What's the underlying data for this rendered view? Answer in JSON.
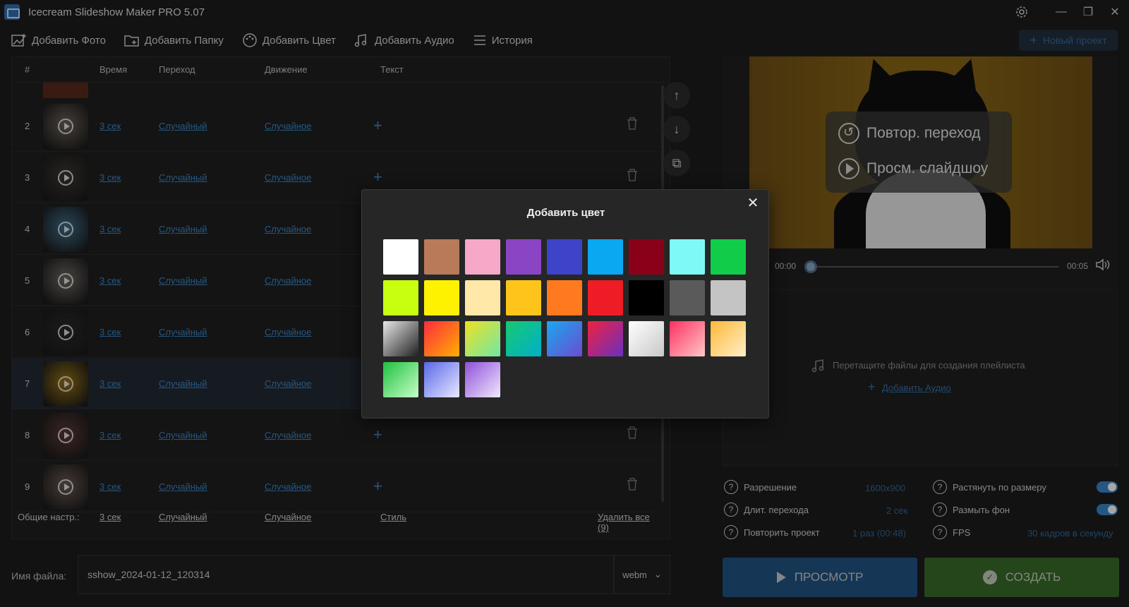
{
  "app": {
    "title": "Icecream Slideshow Maker PRO 5.07"
  },
  "toolbar": {
    "add_photo": "Добавить Фото",
    "add_folder": "Добавить Папку",
    "add_color": "Добавить Цвет",
    "add_audio": "Добавить Аудио",
    "history": "История",
    "new_project": "Новый проект"
  },
  "table": {
    "headers": {
      "num": "#",
      "time": "Время",
      "transition": "Переход",
      "motion": "Движение",
      "text": "Текст"
    },
    "rows": [
      {
        "num": "2",
        "time": "3 сек",
        "transition": "Случайный",
        "motion": "Случайное",
        "thumb_color": "#6b6258"
      },
      {
        "num": "3",
        "time": "3 сек",
        "transition": "Случайный",
        "motion": "Случайное",
        "thumb_color": "#3d3630"
      },
      {
        "num": "4",
        "time": "3 сек",
        "transition": "Случайный",
        "motion": "Случайное",
        "thumb_color": "#3f6f8a"
      },
      {
        "num": "5",
        "time": "3 сек",
        "transition": "Случайный",
        "motion": "Случайное",
        "thumb_color": "#6f6a63"
      },
      {
        "num": "6",
        "time": "3 сек",
        "transition": "Случайный",
        "motion": "Случайное",
        "thumb_color": "#2a2a2a"
      },
      {
        "num": "7",
        "time": "3 сек",
        "transition": "Случайный",
        "motion": "Случайное",
        "thumb_color": "#9a7414"
      },
      {
        "num": "8",
        "time": "3 сек",
        "transition": "Случайный",
        "motion": "Случайное",
        "thumb_color": "#5a3a36"
      },
      {
        "num": "9",
        "time": "3 сек",
        "transition": "Случайный",
        "motion": "Случайное",
        "thumb_color": "#6a5a52"
      }
    ],
    "footer": {
      "label": "Общие настр.:",
      "time": "3 сек",
      "transition": "Случайный",
      "motion": "Случайное",
      "style": "Стиль",
      "delete_all": "Удалить все (9)"
    }
  },
  "file": {
    "label": "Имя файла:",
    "value": "sshow_2024-01-12_120314",
    "format": "webm"
  },
  "preview": {
    "repeat_transition": "Повтор. переход",
    "view_slideshow": "Просм. слайдшоу",
    "time_start": "00:00",
    "time_end": "00:05"
  },
  "playlist": {
    "hint": "Перетащите файлы для создания плейлиста",
    "add_audio": "Добавить Аудио"
  },
  "settings": {
    "resolution_label": "Разрешение",
    "resolution_value": "1600x900",
    "transition_len_label": "Длит. перехода",
    "transition_len_value": "2 сек",
    "repeat_label": "Повторить проект",
    "repeat_value": "1 раз (00:48)",
    "stretch_label": "Растянуть по размеру",
    "blur_label": "Размыть фон",
    "fps_label": "FPS",
    "fps_value": "30 кадров в секунду"
  },
  "actions": {
    "preview": "ПРОСМОТР",
    "create": "СОЗДАТЬ"
  },
  "modal": {
    "title": "Добавить цвет",
    "swatches": [
      "#ffffff",
      "#b87a58",
      "#f7a8c8",
      "#8a45c4",
      "#3d44c8",
      "#0aa8f0",
      "#8a0018",
      "#7ff8f8",
      "#10cc48",
      "#c8ff10",
      "#fff200",
      "#ffe8a8",
      "#ffc41a",
      "#ff7a1e",
      "#ee1c24",
      "#000000",
      "#5a5a5a",
      "#c4c4c4",
      "linear-gradient(135deg,#e8e8e8,#202020)",
      "linear-gradient(135deg,#ff2a40,#ffb000)",
      "linear-gradient(135deg,#f0e020,#70e8a8)",
      "linear-gradient(135deg,#18c870,#00b0c8)",
      "linear-gradient(135deg,#1aa8f0,#6a4cd0)",
      "linear-gradient(135deg,#f02040,#6a30c0)",
      "linear-gradient(135deg,#ffffff,#c8c8c8)",
      "linear-gradient(135deg,#ff3060,#ffc8c8)",
      "linear-gradient(135deg,#ffb838,#fff0c8)",
      "linear-gradient(135deg,#20c040,#c8ffc8)",
      "linear-gradient(135deg,#5868e8,#e8e8ff)",
      "linear-gradient(135deg,#9050d8,#f0e8ff)"
    ]
  }
}
